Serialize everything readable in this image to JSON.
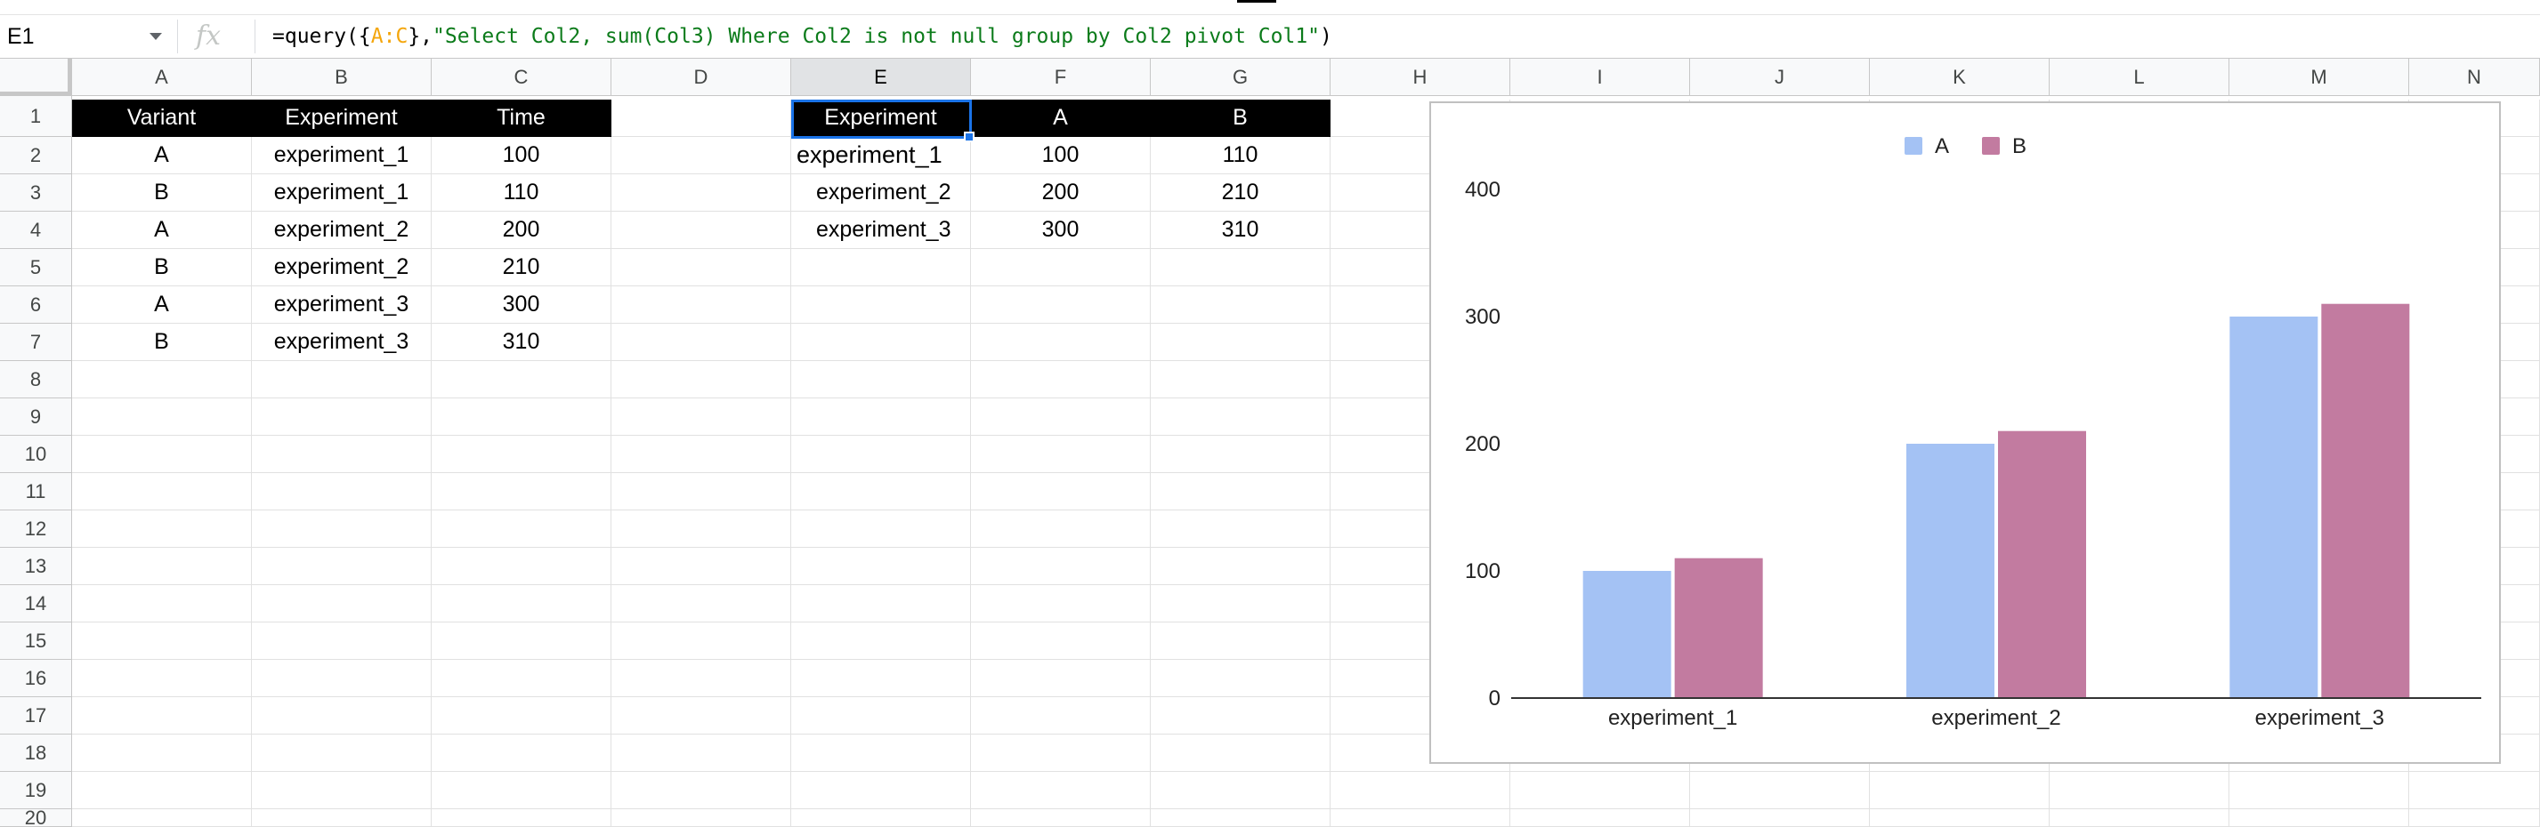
{
  "formula_bar": {
    "cell_ref": "E1",
    "fx": "fx",
    "formula_prefix": "=query({",
    "formula_range": "A:C",
    "formula_mid": "},",
    "formula_string": "\"Select Col2, sum(Col3) Where Col2 is not null group by Col2 pivot Col1\"",
    "formula_suffix": ")"
  },
  "columns": [
    "A",
    "B",
    "C",
    "D",
    "E",
    "F",
    "G",
    "H",
    "I",
    "J",
    "K",
    "L",
    "M",
    "N"
  ],
  "rows": [
    "1",
    "2",
    "3",
    "4",
    "5",
    "6",
    "7",
    "8",
    "9",
    "10",
    "11",
    "12",
    "13",
    "14",
    "15",
    "16",
    "17",
    "18",
    "19",
    "20"
  ],
  "source_table": {
    "headers": [
      "Variant",
      "Experiment",
      "Time"
    ],
    "rows": [
      [
        "A",
        "experiment_1",
        "100"
      ],
      [
        "B",
        "experiment_1",
        "110"
      ],
      [
        "A",
        "experiment_2",
        "200"
      ],
      [
        "B",
        "experiment_2",
        "210"
      ],
      [
        "A",
        "experiment_3",
        "300"
      ],
      [
        "B",
        "experiment_3",
        "310"
      ]
    ]
  },
  "pivot_table": {
    "headers": [
      "Experiment",
      "A",
      "B"
    ],
    "rows": [
      [
        "experiment_1",
        "100",
        "110"
      ],
      [
        "experiment_2",
        "200",
        "210"
      ],
      [
        "experiment_3",
        "300",
        "310"
      ]
    ]
  },
  "chart_data": {
    "type": "bar",
    "categories": [
      "experiment_1",
      "experiment_2",
      "experiment_3"
    ],
    "series": [
      {
        "name": "A",
        "values": [
          100,
          200,
          300
        ],
        "color": "#a4c2f4"
      },
      {
        "name": "B",
        "values": [
          110,
          210,
          310
        ],
        "color": "#c27ba0"
      }
    ],
    "yticks": [
      0,
      100,
      200,
      300,
      400
    ],
    "ylim": [
      0,
      400
    ],
    "legend": "top-center",
    "grid": false
  }
}
